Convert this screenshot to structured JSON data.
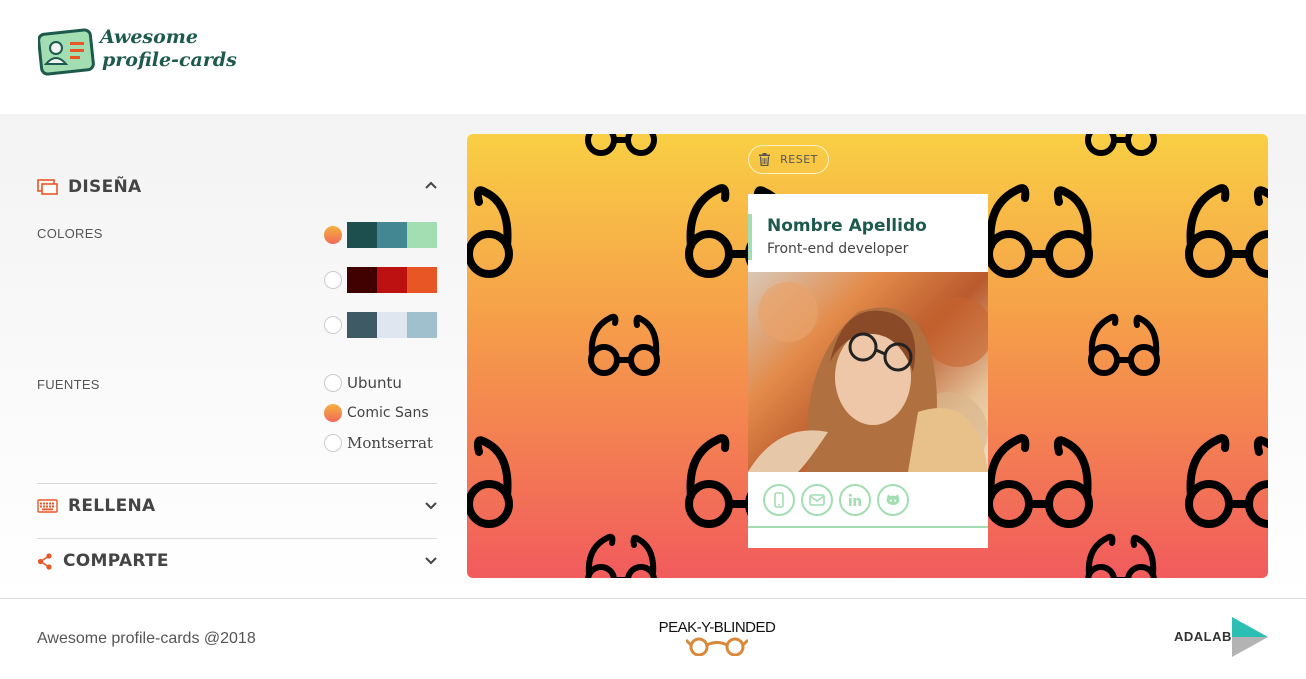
{
  "header": {
    "logo_line1": "Awesome",
    "logo_line2": "profile-cards",
    "logo_icon": "profile-card-icon"
  },
  "design": {
    "title": "DISEÑA",
    "icon": "design-icon",
    "colors_label": "COLORES",
    "palettes": [
      {
        "checked": true,
        "colors": [
          "#1d4f4f",
          "#438792",
          "#a2deb2"
        ]
      },
      {
        "checked": false,
        "colors": [
          "#420101",
          "#bd1010",
          "#e95626"
        ]
      },
      {
        "checked": false,
        "colors": [
          "#3e5b65",
          "#dfe6ef",
          "#a1c0ce"
        ]
      }
    ],
    "fonts_label": "FUENTES",
    "fonts": [
      {
        "name": "Ubuntu",
        "checked": false
      },
      {
        "name": "Comic Sans",
        "checked": true
      },
      {
        "name": "Montserrat",
        "checked": false
      }
    ]
  },
  "fill": {
    "title": "RELLENA",
    "icon": "keyboard-icon"
  },
  "share": {
    "title": "COMPARTE",
    "icon": "share-icon"
  },
  "preview": {
    "reset_label": "RESET",
    "card": {
      "name": "Nombre Apellido",
      "job": "Front-end developer",
      "socials": [
        "phone-icon",
        "email-icon",
        "linkedin-icon",
        "github-icon"
      ]
    }
  },
  "footer": {
    "copyright": "Awesome profile-cards @2018",
    "team": "PEAK-Y-BLINDED",
    "school": "ADALAB"
  }
}
